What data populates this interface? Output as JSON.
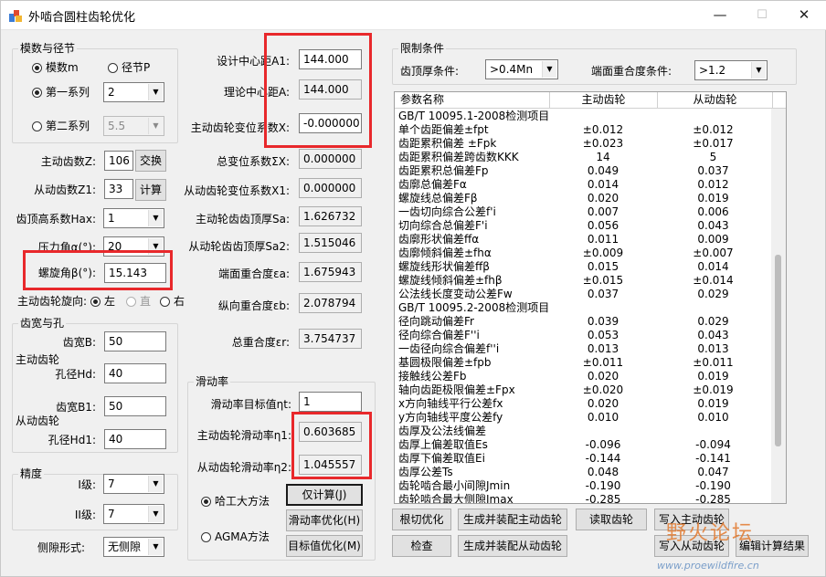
{
  "window": {
    "title": "外啮合圆柱齿轮优化",
    "minimize": "—",
    "maximize": "☐",
    "close": "✕"
  },
  "module": {
    "group": "模数与径节",
    "opt_m": "模数m",
    "opt_p": "径节P",
    "series1": "第一系列",
    "series1_val": "2",
    "series2": "第二系列",
    "series2_val": "5.5"
  },
  "teeth": {
    "z_label": "主动齿数Z:",
    "z": "106",
    "swap": "交换",
    "z1_label": "从动齿数Z1:",
    "z1": "33",
    "calc": "计算",
    "hax_label": "齿顶高系数Hax:",
    "hax": "1",
    "alpha_label": "压力角α(°):",
    "alpha": "20",
    "beta_label": "螺旋角β(°):",
    "beta": "15.143",
    "dir_label": "主动齿轮旋向:",
    "dir_left": "左",
    "dir_straight": "直",
    "dir_right": "右"
  },
  "width": {
    "group": "齿宽与孔",
    "b_label": "齿宽B:",
    "b": "50",
    "drive": "主动齿轮",
    "hd_label": "孔径Hd:",
    "hd": "40",
    "b1_label": "齿宽B1:",
    "b1": "50",
    "driven": "从动齿轮",
    "hd1_label": "孔径Hd1:",
    "hd1": "40"
  },
  "prec": {
    "group": "精度",
    "i_label": "I级:",
    "i": "7",
    "ii_label": "II级:",
    "ii": "7",
    "side_label": "侧隙形式:",
    "side": "无侧隙"
  },
  "center": {
    "a1_label": "设计中心距A1:",
    "a1": "144.000",
    "a_label": "理论中心距A:",
    "a": "144.000",
    "x_label": "主动齿轮变位系数X:",
    "x": "-0.000000",
    "sx_label": "总变位系数ΣX:",
    "sx": "0.000000",
    "x1_label": "从动齿轮变位系数X1:",
    "x1": "0.000000",
    "sa_label": "主动轮齿齿顶厚Sa:",
    "sa": "1.626732",
    "sa2_label": "从动轮齿齿顶厚Sa2:",
    "sa2": "1.515046",
    "ea_label": "端面重合度εa:",
    "ea": "1.675943",
    "eb_label": "纵向重合度εb:",
    "eb": "2.078794",
    "er_label": "总重合度εr:",
    "er": "3.754737"
  },
  "slide": {
    "group": "滑动率",
    "target_label": "滑动率目标值ηt:",
    "target": "1",
    "n1_label": "主动齿轮滑动率η1:",
    "n1": "0.603685",
    "n2_label": "从动齿轮滑动率η2:",
    "n2": "1.045557",
    "m1": "哈工大方法",
    "m2": "AGMA方法",
    "btn_calc": "仅计算(J)",
    "btn_opt": "滑动率优化(H)",
    "btn_target": "目标值优化(M)"
  },
  "limits": {
    "group": "限制条件",
    "tip_label": "齿顶厚条件:",
    "tip": ">0.4Mn",
    "ratio_label": "端面重合度条件:",
    "ratio": ">1.2"
  },
  "table": {
    "headers": [
      "参数名称",
      "主动齿轮",
      "从动齿轮"
    ],
    "rows": [
      [
        "GB/T 10095.1-2008检测项目",
        "",
        ""
      ],
      [
        "单个齿距偏差±fpt",
        "±0.012",
        "±0.012"
      ],
      [
        "齿距累积偏差 ±Fpk",
        "±0.023",
        "±0.017"
      ],
      [
        "齿距累积偏差跨齿数KKK",
        "14",
        "5"
      ],
      [
        "齿距累积总偏差Fp",
        "0.049",
        "0.037"
      ],
      [
        "齿廓总偏差Fα",
        "0.014",
        "0.012"
      ],
      [
        "螺旋线总偏差Fβ",
        "0.020",
        "0.019"
      ],
      [
        "一齿切向综合公差f'i",
        "0.007",
        "0.006"
      ],
      [
        "切向综合总偏差F'i",
        "0.056",
        "0.043"
      ],
      [
        "齿廓形状偏差ffα",
        "0.011",
        "0.009"
      ],
      [
        "齿廓倾斜偏差±fhα",
        "±0.009",
        "±0.007"
      ],
      [
        "螺旋线形状偏差ffβ",
        "0.015",
        "0.014"
      ],
      [
        "螺旋线倾斜偏差±fhβ",
        "±0.015",
        "±0.014"
      ],
      [
        "公法线长度变动公差Fw",
        "0.037",
        "0.029"
      ],
      [
        "GB/T 10095.2-2008检测项目",
        "",
        ""
      ],
      [
        "径向跳动偏差Fr",
        "0.039",
        "0.029"
      ],
      [
        "径向综合偏差F''i",
        "0.053",
        "0.043"
      ],
      [
        "一齿径向综合偏差f''i",
        "0.013",
        "0.013"
      ],
      [
        "基圆极限偏差±fpb",
        "±0.011",
        "±0.011"
      ],
      [
        "接触线公差Fb",
        "0.020",
        "0.019"
      ],
      [
        "轴向齿距极限偏差±Fpx",
        "±0.020",
        "±0.019"
      ],
      [
        "x方向轴线平行公差fx",
        "0.020",
        "0.019"
      ],
      [
        "y方向轴线平度公差fy",
        "0.010",
        "0.010"
      ],
      [
        "齿厚及公法线偏差",
        "",
        ""
      ],
      [
        "齿厚上偏差取值Es",
        "-0.096",
        "-0.094"
      ],
      [
        "齿厚下偏差取值Ei",
        "-0.144",
        "-0.141"
      ],
      [
        "齿厚公差Ts",
        "0.048",
        "0.047"
      ],
      [
        "齿轮啮合最小间隙Jmin",
        "-0.190",
        "-0.190"
      ],
      [
        "齿轮啮合最大侧隙Jmax",
        "-0.285",
        "-0.285"
      ]
    ]
  },
  "buttons": {
    "cut": "根切优化",
    "gen_drive": "生成并装配主动齿轮",
    "read": "读取齿轮",
    "write_drive": "写入主动齿轮",
    "check": "检查",
    "gen_driven": "生成并装配从动齿轮",
    "write_driven": "写入从动齿轮",
    "finish": "编辑计算结果"
  },
  "watermark": {
    "text": "野火论坛",
    "url": "www.proewildfire.cn"
  },
  "colors": {
    "highlight": "#e8282b"
  }
}
